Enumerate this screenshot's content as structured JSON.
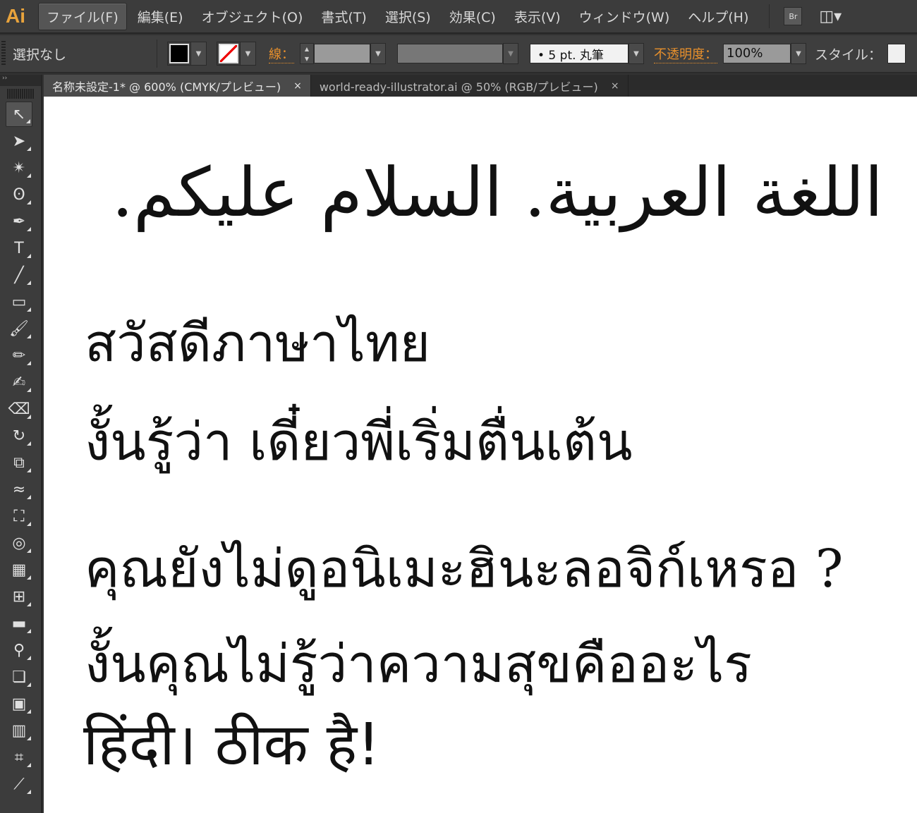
{
  "app": {
    "logo": "Ai"
  },
  "menu": [
    "ファイル(F)",
    "編集(E)",
    "オブジェクト(O)",
    "書式(T)",
    "選択(S)",
    "効果(C)",
    "表示(V)",
    "ウィンドウ(W)",
    "ヘルプ(H)"
  ],
  "bridge_label": "Br",
  "control": {
    "selection": "選択なし",
    "fill_color": "#000000",
    "stroke_label": "線：",
    "brush": "• 5 pt. 丸筆",
    "opacity_label": "不透明度：",
    "opacity_value": "100%",
    "style_label": "スタイル："
  },
  "tabs": [
    {
      "label": "名称未設定-1* @ 600% (CMYK/プレビュー)",
      "close": "×"
    },
    {
      "label": "world-ready-illustrator.ai @ 50% (RGB/プレビュー)",
      "close": "×"
    }
  ],
  "toolbar_header": "››",
  "tools": [
    {
      "name": "selection-tool",
      "glyph": "↖"
    },
    {
      "name": "direct-selection-tool",
      "glyph": "➤"
    },
    {
      "name": "magic-wand-tool",
      "glyph": "✴"
    },
    {
      "name": "lasso-tool",
      "glyph": "ʘ"
    },
    {
      "name": "pen-tool",
      "glyph": "✒"
    },
    {
      "name": "type-tool",
      "glyph": "T"
    },
    {
      "name": "line-tool",
      "glyph": "╱"
    },
    {
      "name": "rectangle-tool",
      "glyph": "▭"
    },
    {
      "name": "paintbrush-tool",
      "glyph": "🖌"
    },
    {
      "name": "pencil-tool",
      "glyph": "✏"
    },
    {
      "name": "blob-brush-tool",
      "glyph": "✍"
    },
    {
      "name": "eraser-tool",
      "glyph": "⌫"
    },
    {
      "name": "rotate-tool",
      "glyph": "↻"
    },
    {
      "name": "scale-tool",
      "glyph": "⧉"
    },
    {
      "name": "warp-tool",
      "glyph": "≈"
    },
    {
      "name": "free-transform-tool",
      "glyph": "⛶"
    },
    {
      "name": "shape-builder-tool",
      "glyph": "◎"
    },
    {
      "name": "perspective-grid-tool",
      "glyph": "▦"
    },
    {
      "name": "mesh-tool",
      "glyph": "⊞"
    },
    {
      "name": "gradient-tool",
      "glyph": "▬"
    },
    {
      "name": "eyedropper-tool",
      "glyph": "⚲"
    },
    {
      "name": "blend-tool",
      "glyph": "❏"
    },
    {
      "name": "symbol-sprayer-tool",
      "glyph": "▣"
    },
    {
      "name": "column-graph-tool",
      "glyph": "▥"
    },
    {
      "name": "artboard-tool",
      "glyph": "⌗"
    },
    {
      "name": "slice-tool",
      "glyph": "⟋"
    }
  ],
  "canvas": {
    "arabic": "اللغة العربية. السلام عليكم.",
    "thai": [
      "สวัสดีภาษาไทย",
      "งั้นรู้ว่า เดี๋ยวพี่เริ่มตื่นเต้น",
      "คุณยังไม่ดูอนิเมะฮินะลอจิก์เหรอ ?",
      "งั้นคุณไม่รู้ว่าความสุขคืออะไร"
    ],
    "hindi": "हिंदी।  ठीक है!"
  }
}
